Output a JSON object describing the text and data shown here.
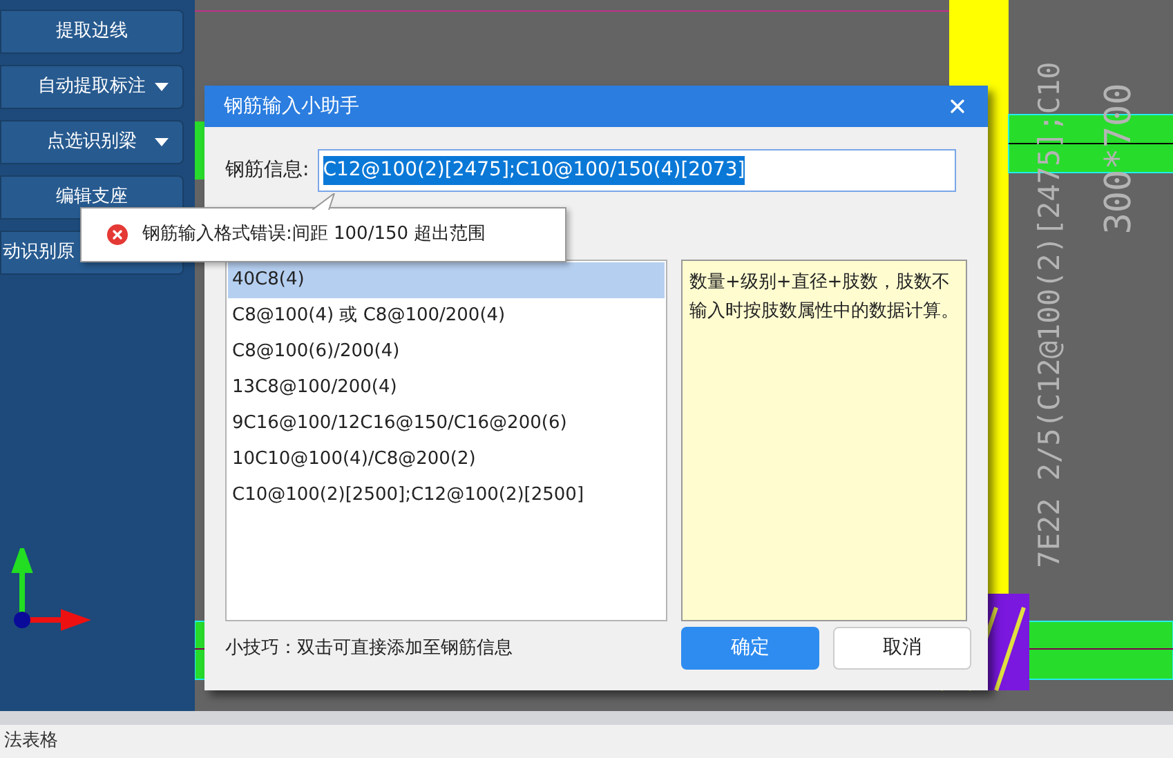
{
  "sidebar": {
    "buttons": [
      {
        "label": "提取边线",
        "dropdown": false
      },
      {
        "label": "自动提取标注",
        "dropdown": true
      },
      {
        "label": "点选识别梁",
        "dropdown": true
      },
      {
        "label": "编辑支座",
        "dropdown": false
      },
      {
        "label": "动识别原",
        "dropdown": false
      }
    ]
  },
  "canvas": {
    "labels": [
      {
        "text": "7E22 2/5(C12@100(2)[2475];C10",
        "color": "#b4b4b4"
      },
      {
        "text": "300*700",
        "color": "#b4b4b4"
      }
    ]
  },
  "dialog": {
    "title": "钢筋输入小助手",
    "field_label": "钢筋信息:",
    "field_value": "C12@100(2)[2475];C10@100/150(4)[2073]",
    "value_selected": true,
    "error_tooltip": "钢筋输入格式错误:间距 100/150 超出范围",
    "examples": [
      {
        "text": "40C8(4)",
        "selected": true
      },
      {
        "text": "C8@100(4) 或 C8@100/200(4)",
        "selected": false
      },
      {
        "text": "C8@100(6)/200(4)",
        "selected": false
      },
      {
        "text": "13C8@100/200(4)",
        "selected": false
      },
      {
        "text": "9C16@100/12C16@150/C16@200(6)",
        "selected": false
      },
      {
        "text": "10C10@100(4)/C8@200(2)",
        "selected": false
      },
      {
        "text": "C10@100(2)[2500];C12@100(2)[2500]",
        "selected": false
      }
    ],
    "hint": "数量+级别+直径+肢数，肢数不输入时按肢数属性中的数据计算。",
    "tip": "小技巧：双击可直接添加至钢筋信息",
    "buttons": [
      {
        "label": "确定",
        "primary": true
      },
      {
        "label": "取消",
        "primary": false
      }
    ]
  },
  "status_bar": {
    "text": "法表格"
  }
}
